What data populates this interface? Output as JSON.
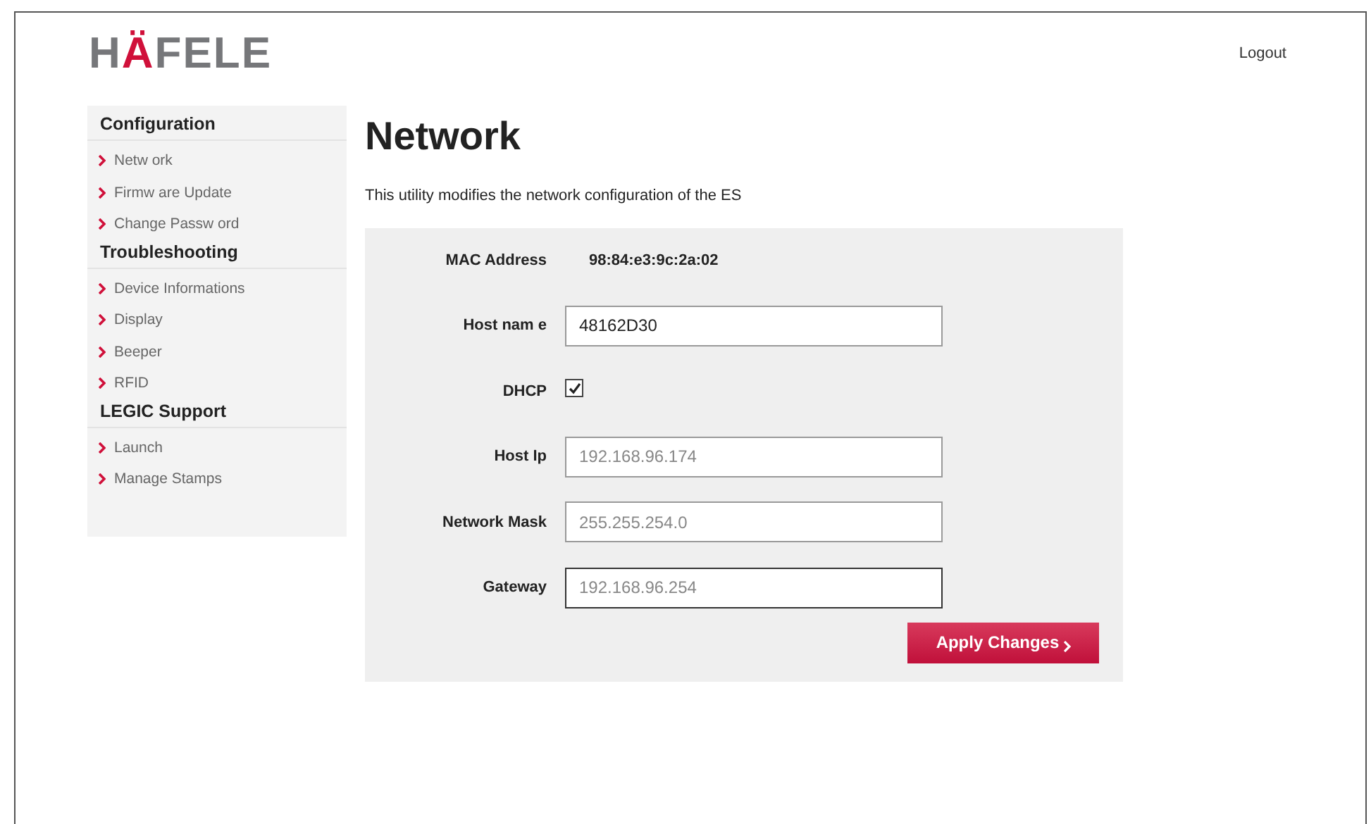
{
  "logo": {
    "parts": [
      {
        "text": "H",
        "accent": false
      },
      {
        "text": "Ä",
        "accent": true
      },
      {
        "text": "FELE",
        "accent": false
      }
    ]
  },
  "logout": "Logout",
  "sidebar": {
    "sections": [
      {
        "title": "Configuration",
        "items": [
          "Netw ork",
          "Firmw are Update",
          "Change Passw ord"
        ]
      },
      {
        "title": "Troubleshooting",
        "items": [
          "Device Informations",
          "Display",
          "Beeper",
          "RFID"
        ]
      },
      {
        "title": "LEGIC Support",
        "items": [
          "Launch",
          "Manage Stamps"
        ]
      }
    ]
  },
  "page": {
    "title": "Network",
    "description": "This utility modifies the network configuration of the ES"
  },
  "form": {
    "fields": [
      {
        "kind": "text",
        "label": "MAC Address",
        "value": "98:84:e3:9c:2a:02"
      },
      {
        "kind": "input",
        "label": "Host nam e",
        "value": "48162D30",
        "disabled": false,
        "focused": false
      },
      {
        "kind": "checkbox",
        "label": "DHCP",
        "checked": true
      },
      {
        "kind": "input",
        "label": "Host Ip",
        "value": "192.168.96.174",
        "disabled": true,
        "focused": false
      },
      {
        "kind": "input",
        "label": "Network Mask",
        "value": "255.255.254.0",
        "disabled": true,
        "focused": false
      },
      {
        "kind": "input",
        "label": "Gateway",
        "value": "192.168.96.254",
        "disabled": true,
        "focused": true
      }
    ],
    "button": "Apply Changes"
  }
}
